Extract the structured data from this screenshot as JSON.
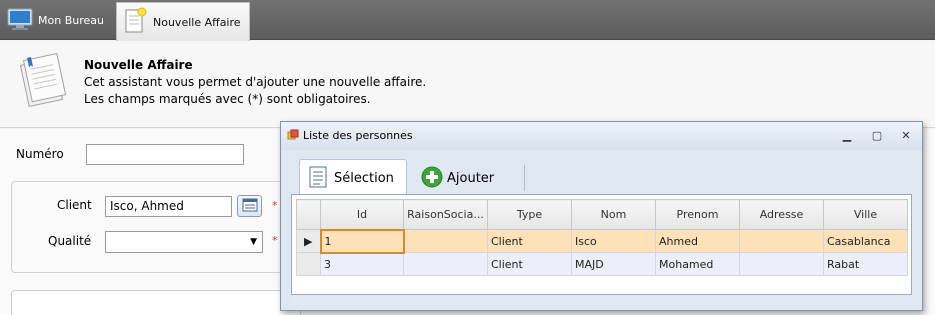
{
  "tabs": {
    "desk": "Mon Bureau",
    "new_affair": "Nouvelle Affaire"
  },
  "header": {
    "title": "Nouvelle Affaire",
    "line1": "Cet assistant vous permet d'ajouter une nouvelle affaire.",
    "line2": "Les champs marqués avec (*) sont obligatoires."
  },
  "form": {
    "numero_label": "Numéro",
    "numero_value": "",
    "client_label": "Client",
    "client_value": "Isco, Ahmed",
    "qualite_label": "Qualité",
    "qualite_value": "",
    "required_mark": "*"
  },
  "dialog": {
    "title": "Liste des personnes",
    "toolbar": {
      "selection": "Sélection",
      "add": "Ajouter"
    },
    "grid": {
      "columns": [
        "Id",
        "RaisonSocia...",
        "Type",
        "Nom",
        "Prenom",
        "Adresse",
        "Ville"
      ],
      "rows": [
        {
          "id": "1",
          "raison": "",
          "type": "Client",
          "nom": "Isco",
          "prenom": "Ahmed",
          "adresse": "",
          "ville": "Casablanca"
        },
        {
          "id": "3",
          "raison": "",
          "type": "Client",
          "nom": "MAJD",
          "prenom": "Mohamed",
          "adresse": "",
          "ville": "Rabat"
        }
      ]
    }
  },
  "colors": {
    "tabbar": "#666666",
    "selected_row": "#fde1b8",
    "alt_row": "#eeeefa",
    "required": "#dd3333",
    "add_icon": "#3aa53a"
  }
}
